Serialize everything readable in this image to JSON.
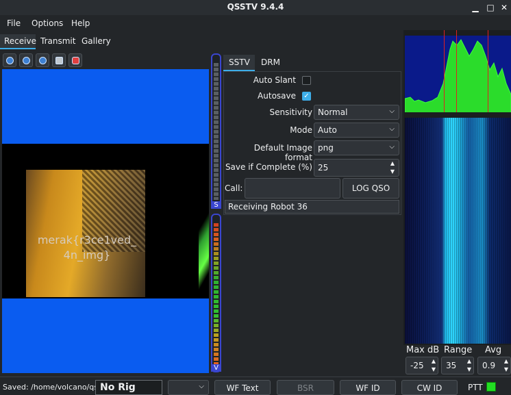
{
  "window": {
    "title": "QSSTV 9.4.4",
    "minimize": "▁",
    "maximize": "□",
    "close": "✕"
  },
  "menu": [
    "File",
    "Options",
    "Help"
  ],
  "tabs": [
    "Receive",
    "Transmit",
    "Gallery"
  ],
  "toolbar_icons": [
    "start-icon",
    "stop-icon",
    "reload-icon",
    "save-icon",
    "erase-icon"
  ],
  "image": {
    "overlay_text_line1": "merak{r3ce1ved_",
    "overlay_text_line2": "4n_img}"
  },
  "vu": {
    "top_label": "S",
    "bottom_label": "V"
  },
  "subtabs": [
    "SSTV",
    "DRM"
  ],
  "settings": {
    "auto_slant_label": "Auto Slant",
    "auto_slant": false,
    "autosave_label": "Autosave",
    "autosave": true,
    "sensitivity_label": "Sensitivity",
    "sensitivity_value": "Normal",
    "mode_label": "Mode",
    "mode_value": "Auto",
    "format_label": "Default Image format",
    "format_value": "png",
    "save_complete_label": "Save if Complete (%)",
    "save_complete_value": "25",
    "call_label": "Call:",
    "call_value": "",
    "log_qso_label": "LOG QSO",
    "status_text": "Receiving Robot 36"
  },
  "spectrum_controls": {
    "max_db_label": "Max dB",
    "max_db_value": "-25",
    "range_label": "Range",
    "range_value": "35",
    "avg_label": "Avg",
    "avg_value": "0.9"
  },
  "statusbar": {
    "saved_text": "Saved: /home/volcano/qsst",
    "rig_text": "No Rig",
    "wf_text_label": "WF Text",
    "bsr_label": "BSR",
    "wf_id_label": "WF ID",
    "cw_id_label": "CW ID",
    "ptt_label": "PTT"
  },
  "colors": {
    "accent": "#3daee9",
    "image_blue": "#0a5cf0",
    "ptt_green": "#22dd22"
  }
}
